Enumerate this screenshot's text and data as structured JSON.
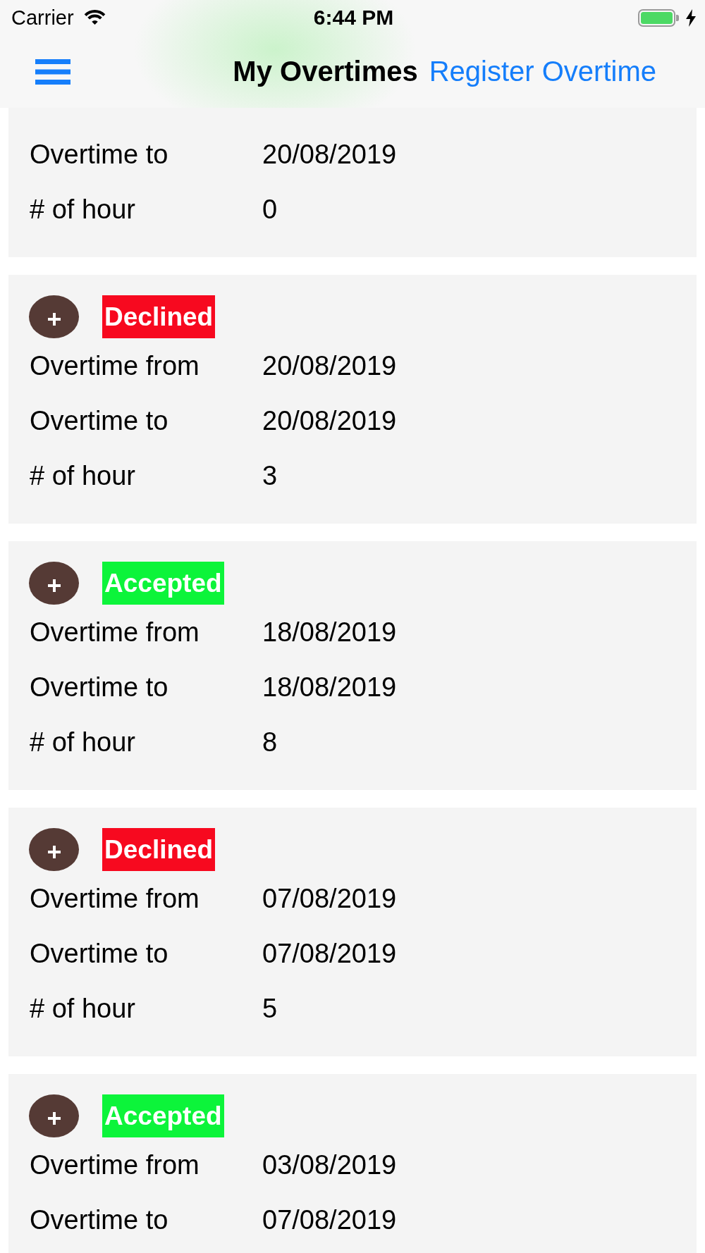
{
  "status_bar": {
    "carrier": "Carrier",
    "time": "6:44 PM"
  },
  "nav_bar": {
    "title": "My Overtimes",
    "action": "Register Overtime"
  },
  "cards": [
    {
      "rows": [
        {
          "label": "Overtime to",
          "value": "20/08/2019"
        },
        {
          "label": "# of hour",
          "value": "0"
        }
      ]
    },
    {
      "status": {
        "label": "Declined",
        "color": "#f7091f"
      },
      "rows": [
        {
          "label": "Overtime from",
          "value": "20/08/2019"
        },
        {
          "label": "Overtime to",
          "value": "20/08/2019"
        },
        {
          "label": "# of hour",
          "value": "3"
        }
      ]
    },
    {
      "status": {
        "label": "Accepted",
        "color": "#0cf43a"
      },
      "rows": [
        {
          "label": "Overtime from",
          "value": "18/08/2019"
        },
        {
          "label": "Overtime to",
          "value": "18/08/2019"
        },
        {
          "label": "# of hour",
          "value": "8"
        }
      ]
    },
    {
      "status": {
        "label": "Declined",
        "color": "#f7091f"
      },
      "rows": [
        {
          "label": "Overtime from",
          "value": "07/08/2019"
        },
        {
          "label": "Overtime to",
          "value": "07/08/2019"
        },
        {
          "label": "# of hour",
          "value": "5"
        }
      ]
    },
    {
      "status": {
        "label": "Accepted",
        "color": "#0cf43a"
      },
      "rows": [
        {
          "label": "Overtime from",
          "value": "03/08/2019"
        },
        {
          "label": "Overtime to",
          "value": "07/08/2019"
        }
      ]
    }
  ]
}
